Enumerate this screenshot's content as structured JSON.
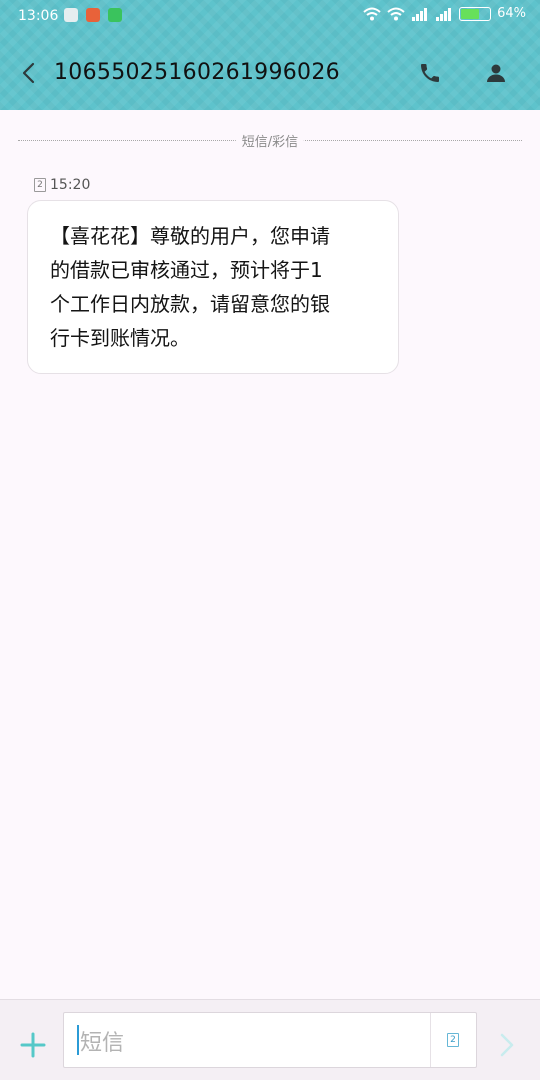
{
  "statusbar": {
    "time": "13:06",
    "battery_percent": "64%"
  },
  "header": {
    "title": "10655025160261996026"
  },
  "thread": {
    "divider_label": "短信/彩信",
    "message": {
      "sim": "2",
      "time": "15:20",
      "text": "【喜花花】尊敬的用户，您申请\n的借款已审核通过，预计将于1\n个工作日内放款，请留意您的银\n行卡到账情况。"
    }
  },
  "composer": {
    "placeholder": "短信",
    "sim": "2"
  },
  "colors": {
    "header": "#5ec3cc",
    "background": "#fdf8fd",
    "accent": "#4fc3c5"
  },
  "icons": {
    "back": "chevron-left-icon",
    "phone": "phone-icon",
    "contact": "contact-icon",
    "plus": "plus-icon",
    "send": "send-icon",
    "sim": "sim-icon"
  }
}
